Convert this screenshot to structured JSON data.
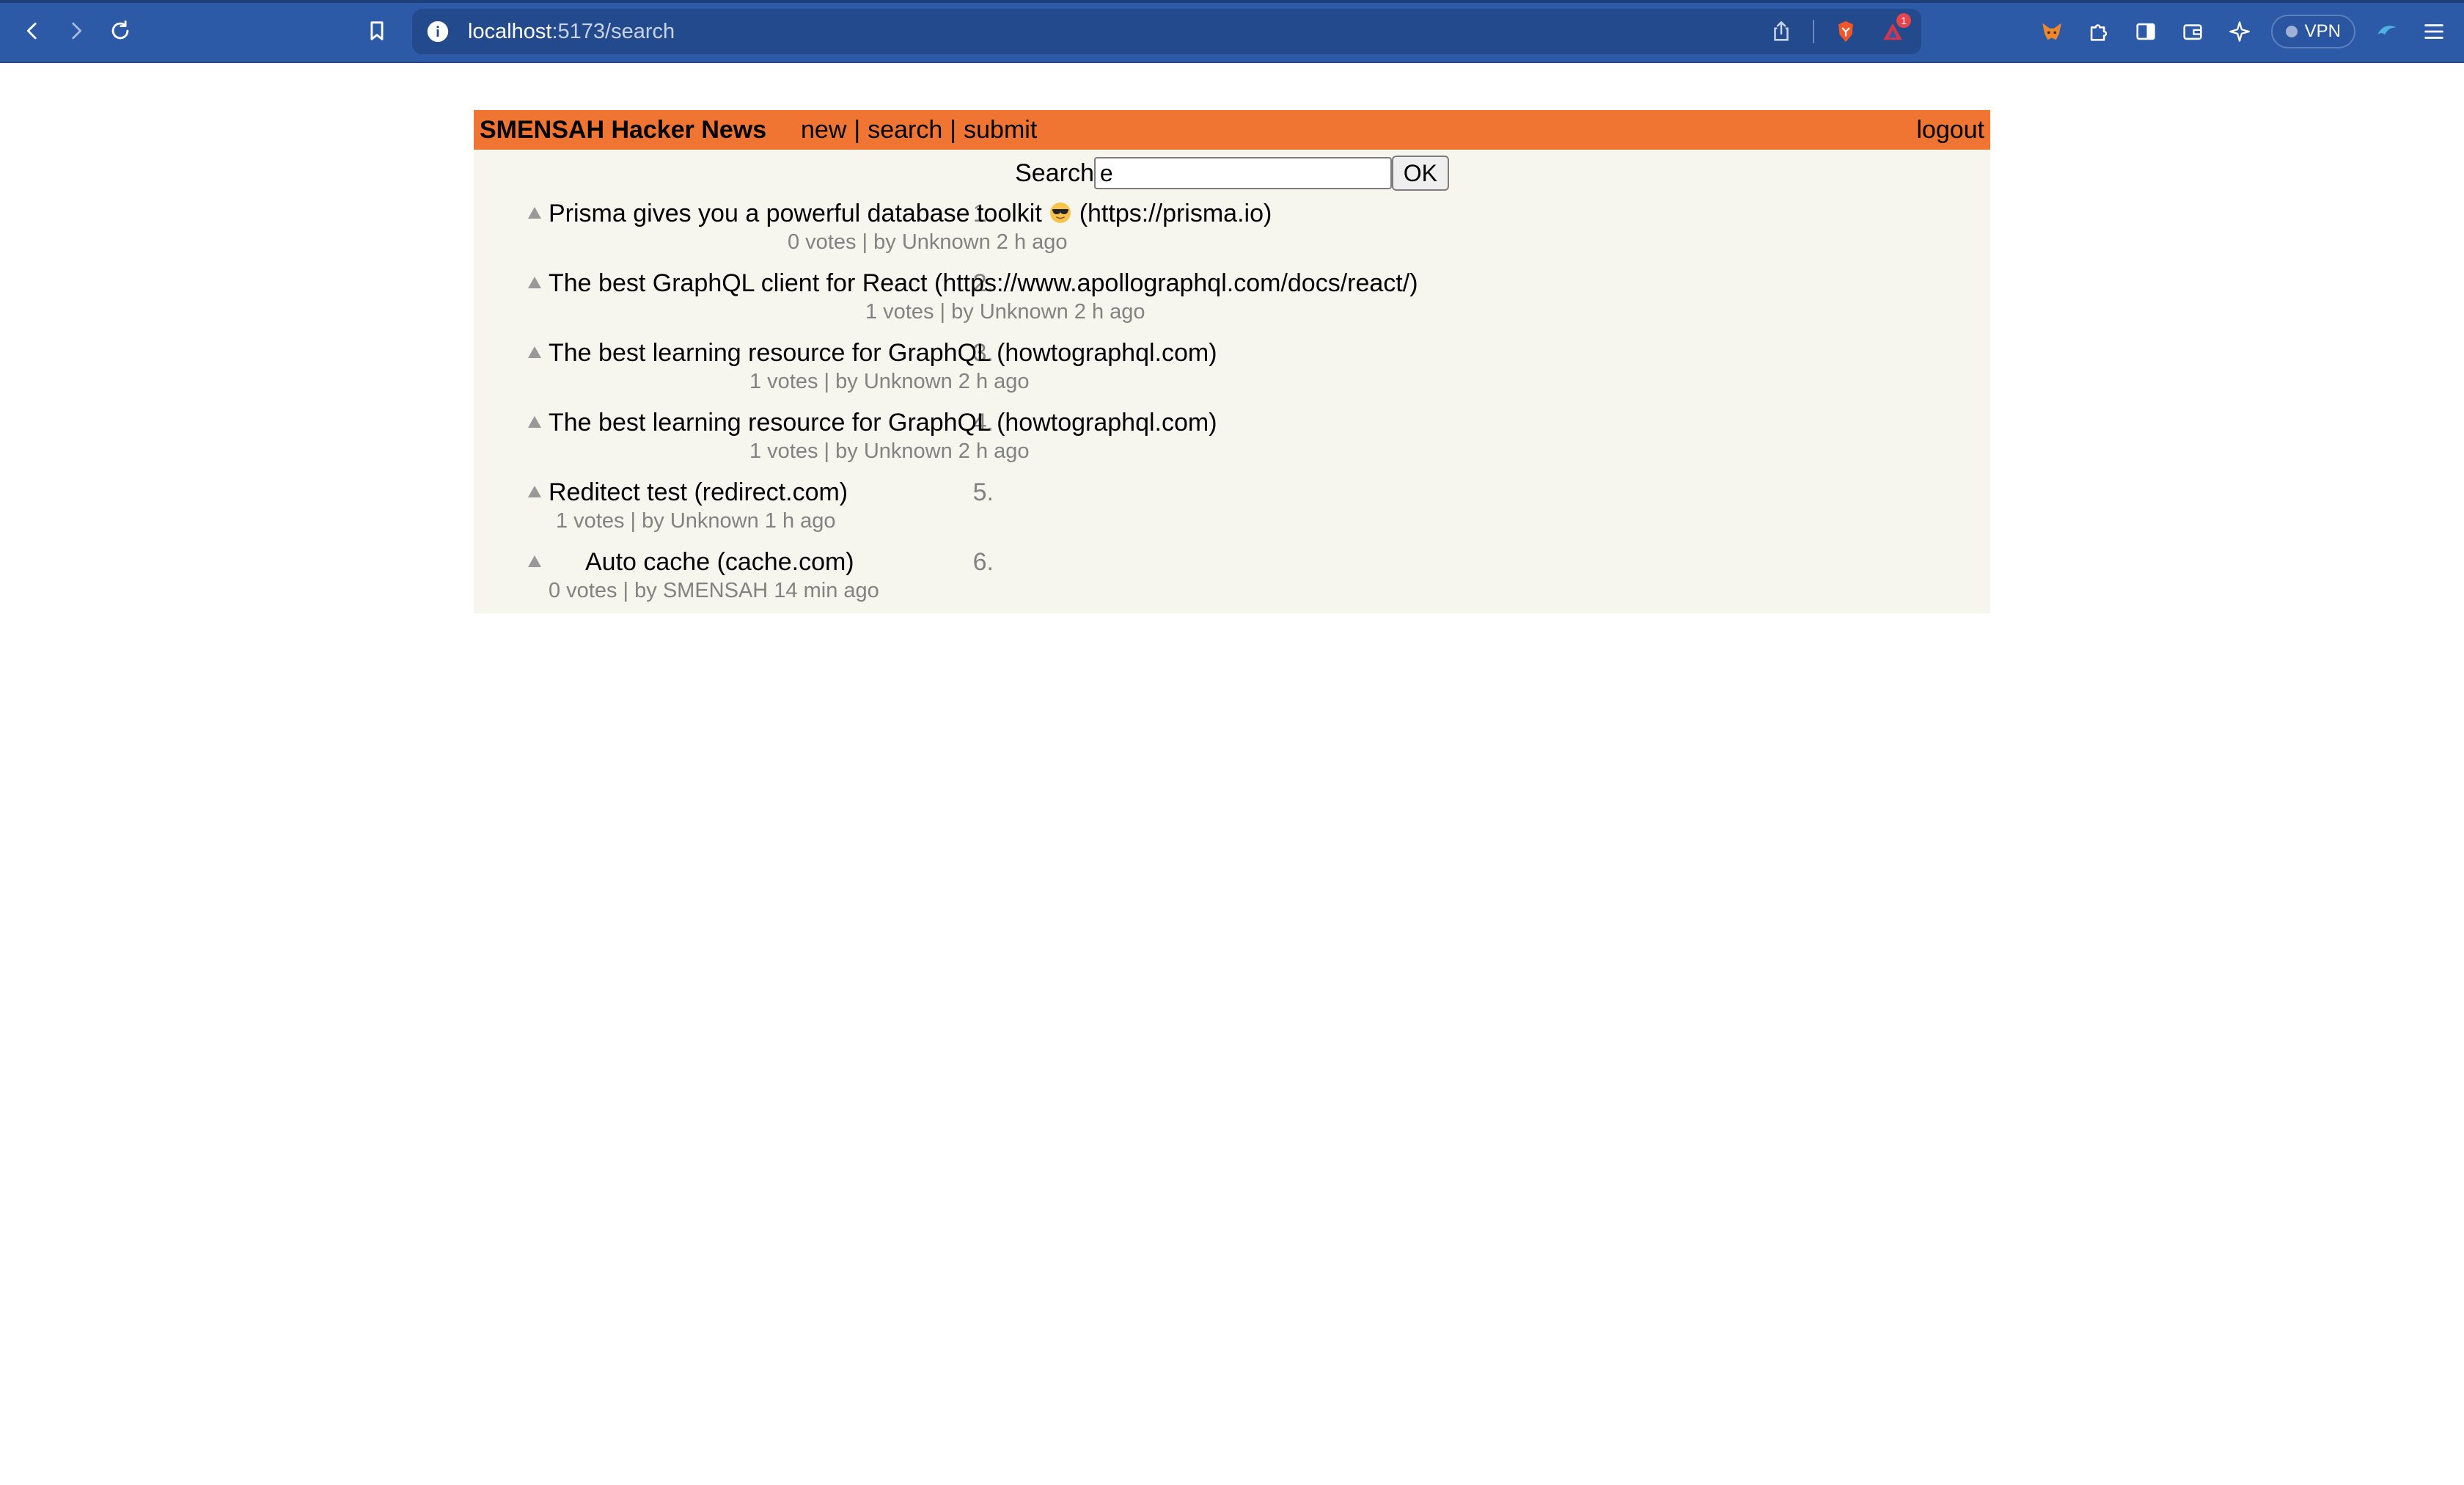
{
  "browser": {
    "url_host": "localhost",
    "url_path": ":5173/search",
    "vpn_label": "VPN",
    "alert_badge": "1"
  },
  "header": {
    "brand": "SMENSAH Hacker News",
    "nav": [
      "new",
      "search",
      "submit"
    ],
    "separator": "|",
    "logout": "logout"
  },
  "search": {
    "label": "Search",
    "value": "e",
    "button": "OK"
  },
  "links": [
    {
      "num": "1.",
      "title": "Prisma gives you a powerful database toolkit",
      "emoji": "sunglasses-emoji",
      "domain": "(https://prisma.io)",
      "meta": "0 votes | by Unknown 2 h ago"
    },
    {
      "num": "2.",
      "title": "The best GraphQL client for React",
      "domain": "(https://www.apollographql.com/docs/react/)",
      "meta": "1 votes | by Unknown 2 h ago"
    },
    {
      "num": "3.",
      "title": "The best learning resource for GraphQL",
      "domain": "(howtographql.com)",
      "meta": "1 votes | by Unknown 2 h ago"
    },
    {
      "num": "4.",
      "title": "The best learning resource for GraphQL",
      "domain": "(howtographql.com)",
      "meta": "1 votes | by Unknown 2 h ago"
    },
    {
      "num": "5.",
      "title": "Reditect test",
      "domain": "(redirect.com)",
      "meta": "1 votes | by Unknown 1 h ago"
    },
    {
      "num": "6.",
      "title": "Auto cache",
      "domain": "(cache.com)",
      "meta": "0 votes | by SMENSAH 14 min ago"
    }
  ],
  "colors": {
    "header_orange": "#f07432",
    "page_bg": "#f6f6ef",
    "meta_gray": "#828282",
    "chrome_blue": "#2d5aa6"
  }
}
